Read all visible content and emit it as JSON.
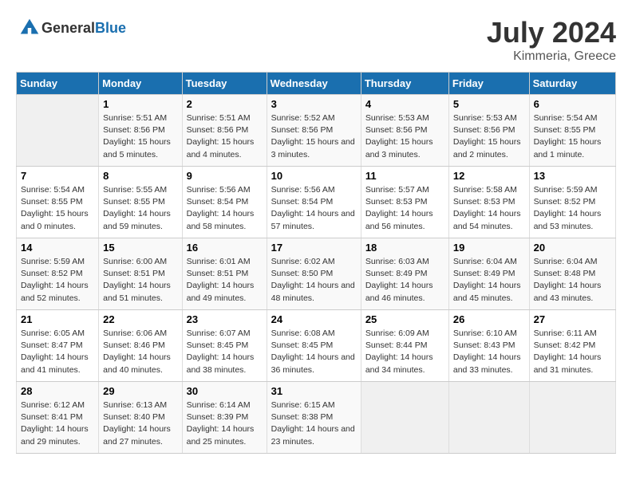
{
  "header": {
    "logo_general": "General",
    "logo_blue": "Blue",
    "title": "July 2024",
    "location": "Kimmeria, Greece"
  },
  "days_of_week": [
    "Sunday",
    "Monday",
    "Tuesday",
    "Wednesday",
    "Thursday",
    "Friday",
    "Saturday"
  ],
  "weeks": [
    [
      {
        "day": "",
        "sunrise": "",
        "sunset": "",
        "daylight": "",
        "empty": true
      },
      {
        "day": "1",
        "sunrise": "Sunrise: 5:51 AM",
        "sunset": "Sunset: 8:56 PM",
        "daylight": "Daylight: 15 hours and 5 minutes."
      },
      {
        "day": "2",
        "sunrise": "Sunrise: 5:51 AM",
        "sunset": "Sunset: 8:56 PM",
        "daylight": "Daylight: 15 hours and 4 minutes."
      },
      {
        "day": "3",
        "sunrise": "Sunrise: 5:52 AM",
        "sunset": "Sunset: 8:56 PM",
        "daylight": "Daylight: 15 hours and 3 minutes."
      },
      {
        "day": "4",
        "sunrise": "Sunrise: 5:53 AM",
        "sunset": "Sunset: 8:56 PM",
        "daylight": "Daylight: 15 hours and 3 minutes."
      },
      {
        "day": "5",
        "sunrise": "Sunrise: 5:53 AM",
        "sunset": "Sunset: 8:56 PM",
        "daylight": "Daylight: 15 hours and 2 minutes."
      },
      {
        "day": "6",
        "sunrise": "Sunrise: 5:54 AM",
        "sunset": "Sunset: 8:55 PM",
        "daylight": "Daylight: 15 hours and 1 minute."
      }
    ],
    [
      {
        "day": "7",
        "sunrise": "Sunrise: 5:54 AM",
        "sunset": "Sunset: 8:55 PM",
        "daylight": "Daylight: 15 hours and 0 minutes."
      },
      {
        "day": "8",
        "sunrise": "Sunrise: 5:55 AM",
        "sunset": "Sunset: 8:55 PM",
        "daylight": "Daylight: 14 hours and 59 minutes."
      },
      {
        "day": "9",
        "sunrise": "Sunrise: 5:56 AM",
        "sunset": "Sunset: 8:54 PM",
        "daylight": "Daylight: 14 hours and 58 minutes."
      },
      {
        "day": "10",
        "sunrise": "Sunrise: 5:56 AM",
        "sunset": "Sunset: 8:54 PM",
        "daylight": "Daylight: 14 hours and 57 minutes."
      },
      {
        "day": "11",
        "sunrise": "Sunrise: 5:57 AM",
        "sunset": "Sunset: 8:53 PM",
        "daylight": "Daylight: 14 hours and 56 minutes."
      },
      {
        "day": "12",
        "sunrise": "Sunrise: 5:58 AM",
        "sunset": "Sunset: 8:53 PM",
        "daylight": "Daylight: 14 hours and 54 minutes."
      },
      {
        "day": "13",
        "sunrise": "Sunrise: 5:59 AM",
        "sunset": "Sunset: 8:52 PM",
        "daylight": "Daylight: 14 hours and 53 minutes."
      }
    ],
    [
      {
        "day": "14",
        "sunrise": "Sunrise: 5:59 AM",
        "sunset": "Sunset: 8:52 PM",
        "daylight": "Daylight: 14 hours and 52 minutes."
      },
      {
        "day": "15",
        "sunrise": "Sunrise: 6:00 AM",
        "sunset": "Sunset: 8:51 PM",
        "daylight": "Daylight: 14 hours and 51 minutes."
      },
      {
        "day": "16",
        "sunrise": "Sunrise: 6:01 AM",
        "sunset": "Sunset: 8:51 PM",
        "daylight": "Daylight: 14 hours and 49 minutes."
      },
      {
        "day": "17",
        "sunrise": "Sunrise: 6:02 AM",
        "sunset": "Sunset: 8:50 PM",
        "daylight": "Daylight: 14 hours and 48 minutes."
      },
      {
        "day": "18",
        "sunrise": "Sunrise: 6:03 AM",
        "sunset": "Sunset: 8:49 PM",
        "daylight": "Daylight: 14 hours and 46 minutes."
      },
      {
        "day": "19",
        "sunrise": "Sunrise: 6:04 AM",
        "sunset": "Sunset: 8:49 PM",
        "daylight": "Daylight: 14 hours and 45 minutes."
      },
      {
        "day": "20",
        "sunrise": "Sunrise: 6:04 AM",
        "sunset": "Sunset: 8:48 PM",
        "daylight": "Daylight: 14 hours and 43 minutes."
      }
    ],
    [
      {
        "day": "21",
        "sunrise": "Sunrise: 6:05 AM",
        "sunset": "Sunset: 8:47 PM",
        "daylight": "Daylight: 14 hours and 41 minutes."
      },
      {
        "day": "22",
        "sunrise": "Sunrise: 6:06 AM",
        "sunset": "Sunset: 8:46 PM",
        "daylight": "Daylight: 14 hours and 40 minutes."
      },
      {
        "day": "23",
        "sunrise": "Sunrise: 6:07 AM",
        "sunset": "Sunset: 8:45 PM",
        "daylight": "Daylight: 14 hours and 38 minutes."
      },
      {
        "day": "24",
        "sunrise": "Sunrise: 6:08 AM",
        "sunset": "Sunset: 8:45 PM",
        "daylight": "Daylight: 14 hours and 36 minutes."
      },
      {
        "day": "25",
        "sunrise": "Sunrise: 6:09 AM",
        "sunset": "Sunset: 8:44 PM",
        "daylight": "Daylight: 14 hours and 34 minutes."
      },
      {
        "day": "26",
        "sunrise": "Sunrise: 6:10 AM",
        "sunset": "Sunset: 8:43 PM",
        "daylight": "Daylight: 14 hours and 33 minutes."
      },
      {
        "day": "27",
        "sunrise": "Sunrise: 6:11 AM",
        "sunset": "Sunset: 8:42 PM",
        "daylight": "Daylight: 14 hours and 31 minutes."
      }
    ],
    [
      {
        "day": "28",
        "sunrise": "Sunrise: 6:12 AM",
        "sunset": "Sunset: 8:41 PM",
        "daylight": "Daylight: 14 hours and 29 minutes."
      },
      {
        "day": "29",
        "sunrise": "Sunrise: 6:13 AM",
        "sunset": "Sunset: 8:40 PM",
        "daylight": "Daylight: 14 hours and 27 minutes."
      },
      {
        "day": "30",
        "sunrise": "Sunrise: 6:14 AM",
        "sunset": "Sunset: 8:39 PM",
        "daylight": "Daylight: 14 hours and 25 minutes."
      },
      {
        "day": "31",
        "sunrise": "Sunrise: 6:15 AM",
        "sunset": "Sunset: 8:38 PM",
        "daylight": "Daylight: 14 hours and 23 minutes."
      },
      {
        "day": "",
        "sunrise": "",
        "sunset": "",
        "daylight": "",
        "empty": true
      },
      {
        "day": "",
        "sunrise": "",
        "sunset": "",
        "daylight": "",
        "empty": true
      },
      {
        "day": "",
        "sunrise": "",
        "sunset": "",
        "daylight": "",
        "empty": true
      }
    ]
  ]
}
